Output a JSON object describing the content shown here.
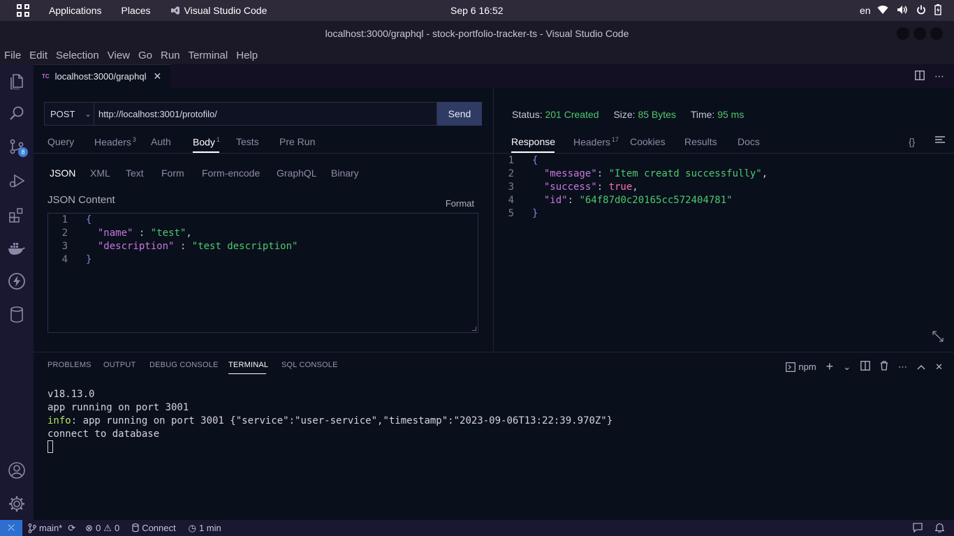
{
  "gnome": {
    "applications": "Applications",
    "places": "Places",
    "app_name": "Visual Studio Code",
    "clock": "Sep 6  16:52",
    "lang": "en"
  },
  "window": {
    "title": "localhost:3000/graphql - stock-portfolio-tracker-ts - Visual Studio Code"
  },
  "menu": [
    "File",
    "Edit",
    "Selection",
    "View",
    "Go",
    "Run",
    "Terminal",
    "Help"
  ],
  "activity": {
    "scm_badge": "8"
  },
  "tab": {
    "icon_text": "TC",
    "label": "localhost:3000/graphql"
  },
  "request": {
    "method": "POST",
    "url": "http://localhost:3001/protofilo/",
    "send": "Send",
    "tabs": {
      "query": "Query",
      "headers": "Headers",
      "headers_count": "3",
      "auth": "Auth",
      "body": "Body",
      "body_count": "1",
      "tests": "Tests",
      "prerun": "Pre Run"
    },
    "body_tabs": [
      "JSON",
      "XML",
      "Text",
      "Form",
      "Form-encode",
      "GraphQL",
      "Binary"
    ],
    "json_label": "JSON Content",
    "format": "Format",
    "code": [
      {
        "ln": "1",
        "open": "{"
      },
      {
        "ln": "2",
        "key": "\"name\"",
        "sep": " : ",
        "val": "\"test\"",
        "end": ","
      },
      {
        "ln": "3",
        "key": "\"description\"",
        "sep": " : ",
        "val": "\"test description\"",
        "end": ""
      },
      {
        "ln": "4",
        "close": "}"
      }
    ]
  },
  "response": {
    "status_label": "Status:",
    "status_value": "201 Created",
    "size_label": "Size:",
    "size_value": "85 Bytes",
    "time_label": "Time:",
    "time_value": "95 ms",
    "tabs": {
      "response": "Response",
      "headers": "Headers",
      "headers_count": "17",
      "cookies": "Cookies",
      "results": "Results",
      "docs": "Docs",
      "braces": "{}"
    },
    "code": [
      {
        "ln": "1",
        "text": "{"
      },
      {
        "ln": "2",
        "key": "\"message\"",
        "val": "\"Item creatd successfully\"",
        "end": ","
      },
      {
        "ln": "3",
        "key": "\"success\"",
        "val": "true",
        "end": ","
      },
      {
        "ln": "4",
        "key": "\"id\"",
        "val": "\"64f87d0c20165cc572404781\"",
        "end": ""
      },
      {
        "ln": "5",
        "text": "}"
      }
    ]
  },
  "panel": {
    "tabs": [
      "PROBLEMS",
      "OUTPUT",
      "DEBUG CONSOLE",
      "TERMINAL",
      "SQL CONSOLE"
    ],
    "active_tab": "TERMINAL",
    "shell": "npm",
    "terminal": {
      "line1": "v18.13.0",
      "line2": "app running on port 3001",
      "line3_prefix": "info",
      "line3_rest": ": app running on port 3001 {\"service\":\"user-service\",\"timestamp\":\"2023-09-06T13:22:39.970Z\"}",
      "line4": "connect to database"
    }
  },
  "statusbar": {
    "branch": "main*",
    "errors": "0",
    "warnings": "0",
    "connect": "Connect",
    "time": "1 min"
  }
}
